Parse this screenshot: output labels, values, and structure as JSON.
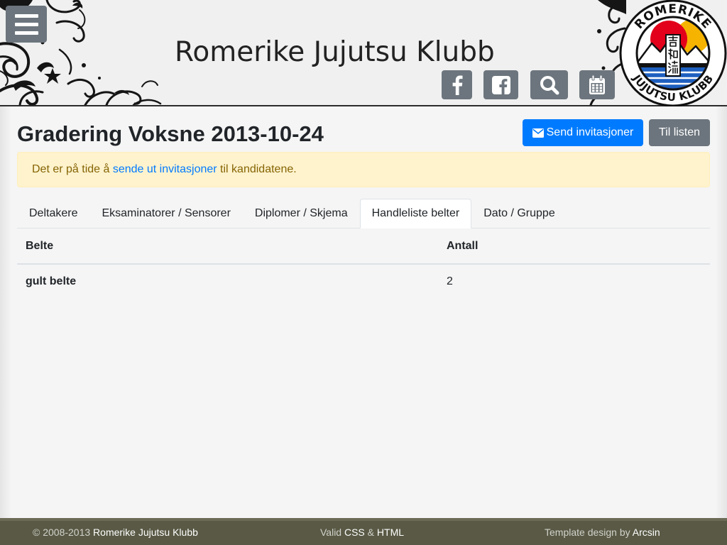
{
  "header": {
    "menu_icon": "hamburger-menu-icon",
    "site_title": "Romerike Jujutsu Klubb",
    "social_buttons": [
      {
        "icon": "facebook-icon"
      },
      {
        "icon": "facebook-square-icon"
      },
      {
        "icon": "search-icon"
      },
      {
        "icon": "calendar-icon"
      }
    ],
    "logo": {
      "top_text": "ROMERIKE",
      "bottom_text": "JUJUTSU KLUBB",
      "emblem_text": "啓和流"
    }
  },
  "page": {
    "title": "Gradering Voksne 2013-10-24",
    "send_button": {
      "icon": "envelope-icon",
      "label": "Send invitasjoner"
    },
    "list_button_label": "Til listen"
  },
  "alert": {
    "text_before": "Det er på tide å ",
    "link_text": "sende ut invitasjoner",
    "text_after": " til kandidatene."
  },
  "tabs": [
    {
      "label": "Deltakere",
      "active": false
    },
    {
      "label": "Eksaminatorer / Sensorer",
      "active": false
    },
    {
      "label": "Diplomer / Skjema",
      "active": false
    },
    {
      "label": "Handleliste belter",
      "active": true
    },
    {
      "label": "Dato / Gruppe",
      "active": false
    }
  ],
  "table": {
    "headers": [
      "Belte",
      "Antall"
    ],
    "rows": [
      [
        "gult belte",
        "2"
      ]
    ]
  },
  "footer": {
    "copyright_prefix": "© 2008-2013 ",
    "club_link": "Romerike Jujutsu Klubb",
    "valid_prefix": "Valid ",
    "css_link": "CSS",
    "separator": " & ",
    "html_link": "HTML",
    "template_prefix": "Template design by ",
    "designer_link": "Arcsin"
  },
  "colors": {
    "primary": "#007bff",
    "secondary": "#6c757d",
    "alert_background": "#fff3cd",
    "alert_text": "#856404",
    "footer_background": "#595945",
    "logo_red": "#e2001a",
    "logo_yellow": "#f6b400",
    "logo_blue": "#1d5fbf"
  }
}
